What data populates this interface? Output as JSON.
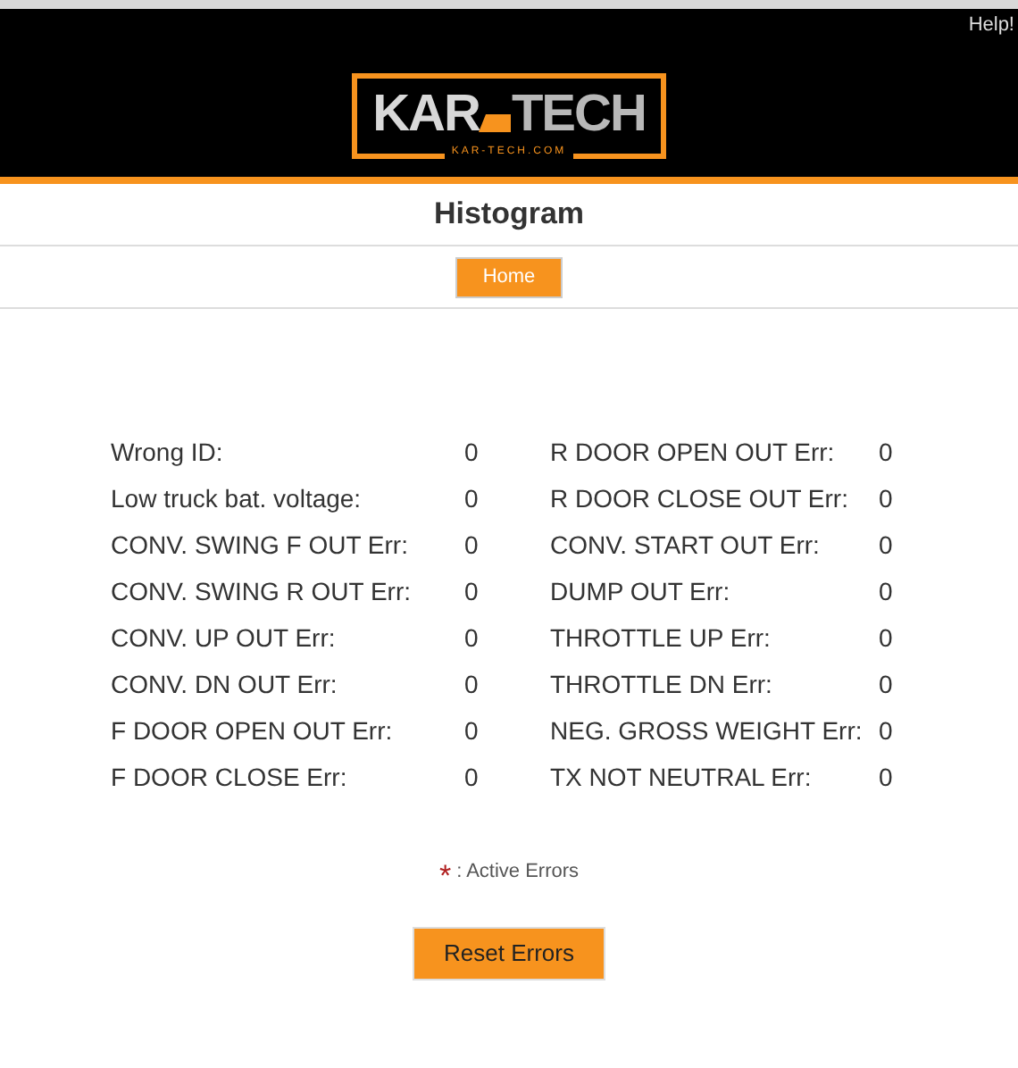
{
  "header": {
    "help_link": "Help!",
    "logo": {
      "left": "KAR",
      "right": "TECH",
      "domain": "KAR-TECH.COM"
    }
  },
  "title": "Histogram",
  "nav": {
    "home_button": "Home"
  },
  "errors": {
    "left": [
      {
        "label": "Wrong ID:",
        "value": "0"
      },
      {
        "label": "Low truck bat. voltage:",
        "value": "0"
      },
      {
        "label": "CONV. SWING F OUT Err:",
        "value": "0"
      },
      {
        "label": "CONV. SWING R OUT Err:",
        "value": "0"
      },
      {
        "label": "CONV. UP OUT Err:",
        "value": "0"
      },
      {
        "label": "CONV. DN OUT Err:",
        "value": "0"
      },
      {
        "label": "F DOOR OPEN OUT Err:",
        "value": "0"
      },
      {
        "label": "F DOOR CLOSE Err:",
        "value": "0"
      }
    ],
    "right": [
      {
        "label": "R DOOR OPEN OUT Err:",
        "value": "0"
      },
      {
        "label": "R DOOR CLOSE OUT Err:",
        "value": "0"
      },
      {
        "label": "CONV. START OUT Err:",
        "value": "0"
      },
      {
        "label": "DUMP OUT Err:",
        "value": "0"
      },
      {
        "label": "THROTTLE UP Err:",
        "value": "0"
      },
      {
        "label": "THROTTLE DN Err:",
        "value": "0"
      },
      {
        "label": "NEG. GROSS WEIGHT Err:",
        "value": "0"
      },
      {
        "label": "TX NOT NEUTRAL Err:",
        "value": "0"
      }
    ]
  },
  "legend": {
    "mark": "*",
    "text": ": Active Errors"
  },
  "reset_button": "Reset Errors"
}
